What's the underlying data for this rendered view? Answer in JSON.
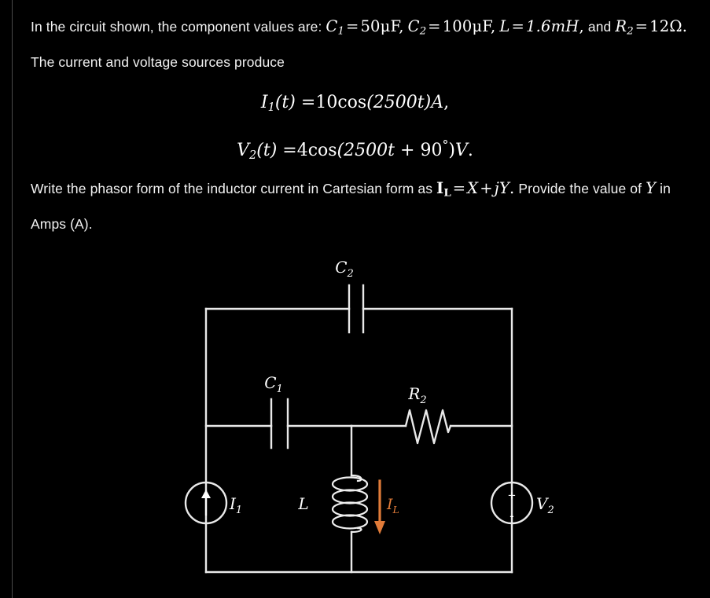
{
  "question": {
    "paragraph1": {
      "t1": "In the circuit shown, the component values are: ",
      "c1_sym": "C",
      "c1_sub": "1",
      "eq1": "=",
      "c1_val": "50μF",
      "comma1": ",",
      "c2_sym": "C",
      "c2_sub": "2",
      "eq2": "=",
      "c2_val": "100μF",
      "comma2": ",",
      "l_sym": "L",
      "eq3": "=",
      "l_val": "1.6mH",
      "comma3": ",",
      "t2": "and ",
      "r2_sym": "R",
      "r2_sub": "2",
      "eq4": "=",
      "r2_val": "12Ω",
      "period1": ".",
      "t3": "The current and voltage sources produce"
    },
    "equations": [
      {
        "lhs_sym": "I",
        "lhs_sub": "1",
        "lhs_arg": "(t)",
        "eq": "=",
        "amp": "10",
        "fn": "cos",
        "arg": "(2500t)",
        "unit": "A",
        "trail": ","
      },
      {
        "lhs_sym": "V",
        "lhs_sub": "2",
        "lhs_arg": "(t)",
        "eq": "=",
        "amp": "4",
        "fn": "cos",
        "arg_open": "(2500t",
        "plus": "+",
        "phase": "90",
        "degree": "°",
        "arg_close": ")",
        "unit": "V",
        "trail": "."
      }
    ],
    "paragraph2": {
      "t1": "Write the phasor form of the inductor current in Cartesian form as ",
      "il_sym": "I",
      "il_sub": "L",
      "eq": "=",
      "x_sym": "X",
      "plus": "+",
      "j_sym": "j",
      "y_sym": "Y",
      "period": ".",
      "t2": "Provide the value of ",
      "y_sym2": "Y",
      "t3": " in Amps (A)."
    }
  },
  "circuit": {
    "labels": {
      "c2": "C",
      "c2_sub": "2",
      "c1": "C",
      "c1_sub": "1",
      "r2": "R",
      "r2_sub": "2",
      "l": "L",
      "il": "I",
      "il_sub": "L",
      "i1": "I",
      "i1_sub": "1",
      "v2": "V",
      "v2_sub": "2",
      "source_plus": "+",
      "source_minus": "-"
    },
    "colors": {
      "wire": "#e9e9e9",
      "label": "#ffffff",
      "current_arrow": "#e07b39",
      "background": "#000000"
    },
    "components": [
      {
        "name": "current-source-I1",
        "type": "current-source"
      },
      {
        "name": "capacitor-C1",
        "type": "capacitor"
      },
      {
        "name": "capacitor-C2",
        "type": "capacitor"
      },
      {
        "name": "inductor-L",
        "type": "inductor"
      },
      {
        "name": "resistor-R2",
        "type": "resistor"
      },
      {
        "name": "voltage-source-V2",
        "type": "voltage-source"
      }
    ]
  }
}
